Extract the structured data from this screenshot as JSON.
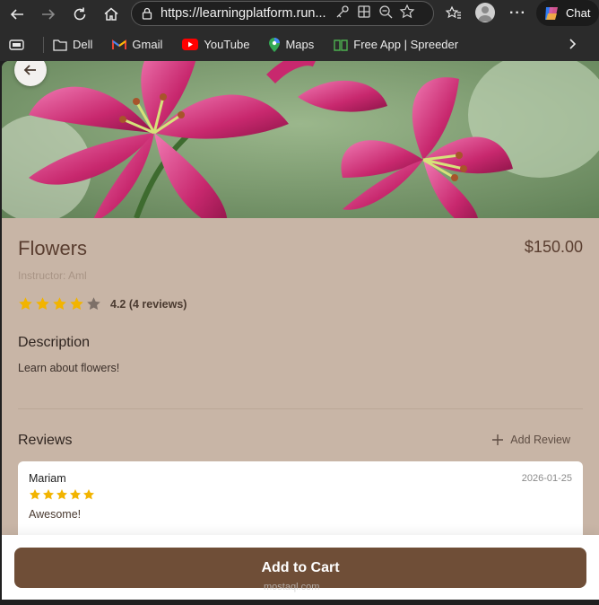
{
  "browser": {
    "url": "https://learningplatform.run...",
    "chat_label": "Chat",
    "bookmarks": [
      "Dell",
      "Gmail",
      "YouTube",
      "Maps",
      "Free App | Spreeder"
    ]
  },
  "course": {
    "title": "Flowers",
    "price": "$150.00",
    "instructor": "Instructor: Aml",
    "rating": 4.2,
    "rating_text": "4.2 (4 reviews)",
    "description_heading": "Description",
    "description": "Learn about flowers!"
  },
  "reviews": {
    "heading": "Reviews",
    "add_label": "Add Review",
    "items": [
      {
        "name": "Mariam",
        "date": "2026-01-25",
        "stars": 5,
        "comment": "Awesome!"
      }
    ]
  },
  "footer": {
    "cart_label": "Add to Cart"
  },
  "watermark": "mostaql.com",
  "colors": {
    "accent": "#6f4e37",
    "star": "#f2b400",
    "page_bg": "#c8b5a6"
  }
}
